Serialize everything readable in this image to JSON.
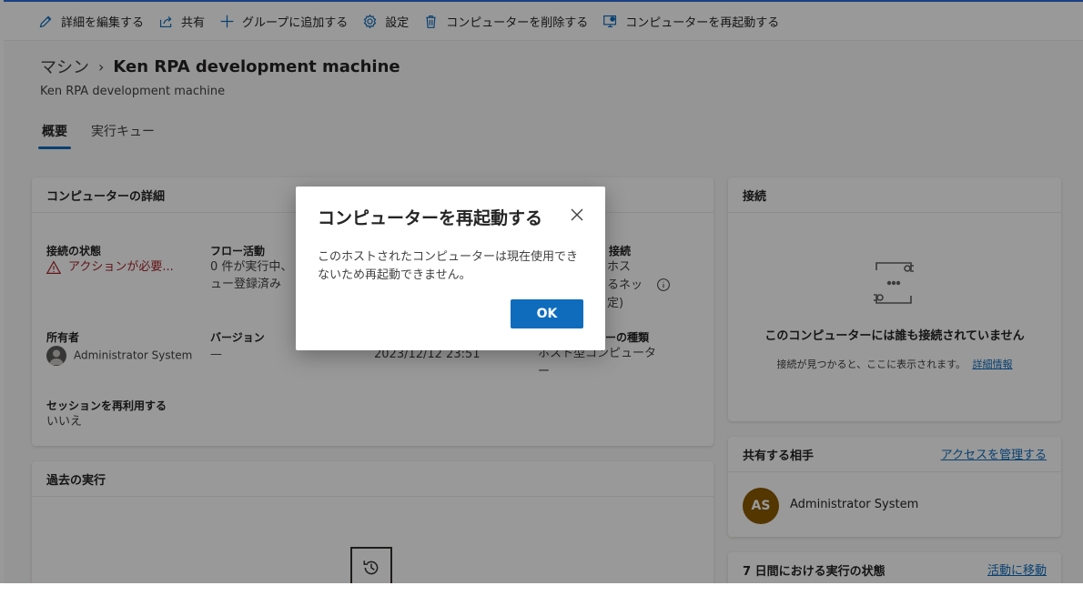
{
  "toolbar": {
    "edit_label": "詳細を編集する",
    "share_label": "共有",
    "add_group_label": "グループに追加する",
    "settings_label": "設定",
    "delete_label": "コンピューターを削除する",
    "restart_label": "コンピューターを再起動する"
  },
  "breadcrumb": {
    "root": "マシン",
    "separator": "›",
    "current": "Ken RPA development machine"
  },
  "subtitle": "Ken RPA development machine",
  "tabs": [
    {
      "label": "概要"
    },
    {
      "label": "実行キュー"
    }
  ],
  "details": {
    "title": "コンピューターの詳細",
    "connection_status_label": "接続の状態",
    "connection_status_value": "アクションが必要...",
    "flow_activity_label": "フロー活動",
    "flow_activity_value_1": "0 件が実行中、",
    "flow_activity_value_2": "ュー登録済み",
    "connection_label": "接続",
    "connection_value_1": "ホス",
    "connection_value_2": "るネッ",
    "connection_value_3": "定)",
    "owner_label": "所有者",
    "owner_value": "Administrator System",
    "version_label": "バージョン",
    "version_value": "—",
    "date_value": "2023/12/12 23:51",
    "type_label": "ーの種類",
    "type_value_1": "ホスト型コンピュータ",
    "type_value_2": "ー",
    "reuse_label": "セッションを再利用する",
    "reuse_value": "いいえ"
  },
  "past_runs": {
    "title": "過去の実行"
  },
  "connections": {
    "title": "接続",
    "empty_title": "このコンピューターには誰も接続されていません",
    "empty_desc": "接続が見つかると、ここに表示されます。",
    "details_link": "詳細情報"
  },
  "shared": {
    "title": "共有する相手",
    "manage_link": "アクセスを管理する",
    "user_initials": "AS",
    "user_name": "Administrator System"
  },
  "run_status": {
    "title": "7 日間における実行の状態",
    "activity_link": "活動に移動"
  },
  "dialog": {
    "title": "コンピューターを再起動する",
    "message": "このホストされたコンピューターは現在使用できないため再起動できません。",
    "ok_label": "OK"
  },
  "colors": {
    "accent": "#0f6cbd",
    "warning": "#a4262c",
    "avatar_bg": "#8a5a00"
  }
}
